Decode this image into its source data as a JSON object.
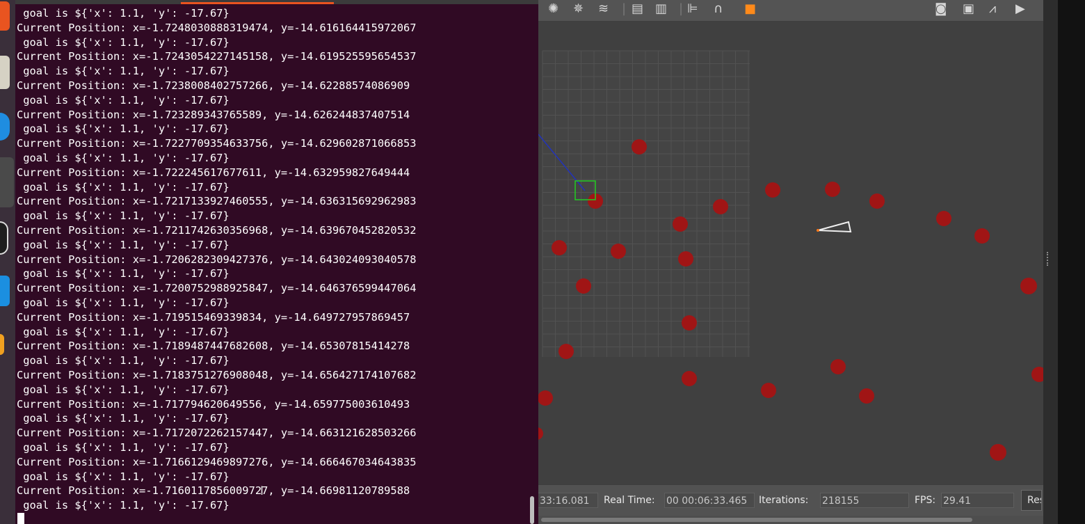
{
  "terminal": {
    "lines": [
      " goal is ${'x': 1.1, 'y': -17.67}",
      "Current Position: x=-1.7248030888319474, y=-14.616164415972067",
      " goal is ${'x': 1.1, 'y': -17.67}",
      "Current Position: x=-1.7243054227145158, y=-14.619525595654537",
      " goal is ${'x': 1.1, 'y': -17.67}",
      "Current Position: x=-1.7238008402757266, y=-14.62288574086909",
      " goal is ${'x': 1.1, 'y': -17.67}",
      "Current Position: x=-1.723289343765589, y=-14.626244837407514",
      " goal is ${'x': 1.1, 'y': -17.67}",
      "Current Position: x=-1.7227709354633756, y=-14.629602871066853",
      " goal is ${'x': 1.1, 'y': -17.67}",
      "Current Position: x=-1.722245617677611, y=-14.632959827649444",
      " goal is ${'x': 1.1, 'y': -17.67}",
      "Current Position: x=-1.7217133927460555, y=-14.636315692962983",
      " goal is ${'x': 1.1, 'y': -17.67}",
      "Current Position: x=-1.7211742630356968, y=-14.639670452820532",
      " goal is ${'x': 1.1, 'y': -17.67}",
      "Current Position: x=-1.7206282309427376, y=-14.643024093040578",
      " goal is ${'x': 1.1, 'y': -17.67}",
      "Current Position: x=-1.7200752988925847, y=-14.646376599447064",
      " goal is ${'x': 1.1, 'y': -17.67}",
      "Current Position: x=-1.719515469339834, y=-14.649727957869457",
      " goal is ${'x': 1.1, 'y': -17.67}",
      "Current Position: x=-1.7189487447682608, y=-14.65307815414278",
      " goal is ${'x': 1.1, 'y': -17.67}",
      "Current Position: x=-1.7183751276908048, y=-14.656427174107682",
      " goal is ${'x': 1.1, 'y': -17.67}",
      "Current Position: x=-1.717794620649556, y=-14.659775003610493",
      " goal is ${'x': 1.1, 'y': -17.67}",
      "Current Position: x=-1.7172072262157447, y=-14.663121628503266",
      " goal is ${'x': 1.1, 'y': -17.67}",
      "Current Position: x=-1.7166129469897276, y=-14.666467034643835",
      " goal is ${'x': 1.1, 'y': -17.67}",
      "Current Position: x=-1.7160117856009727, y=-14.66981120789588",
      " goal is ${'x': 1.1, 'y': -17.67}"
    ],
    "colors": {
      "background": "#300a24",
      "text": "#ffffff",
      "tab_accent": "#e95420"
    }
  },
  "dock": {
    "icons": [
      "ubuntu-software-icon",
      "files-icon",
      "browser-icon",
      "app-icon",
      "github-icon",
      "vscode-icon",
      "terminal-icon"
    ]
  },
  "gazebo": {
    "toolbar_icons": [
      "sun-light-icon",
      "spot-light-icon",
      "directional-light-icon",
      "copy-icon",
      "paste-icon",
      "align-icon",
      "snap-magnet-icon",
      "color-box-icon",
      "screenshot-camera-icon",
      "log-icon",
      "plot-icon",
      "video-record-icon"
    ],
    "status": {
      "sim_time_value": "33:16.081",
      "real_time_label": "Real Time:",
      "real_time_value": "00 00:06:33.465",
      "iterations_label": "Iterations:",
      "iterations_value": "218155",
      "fps_label": "FPS:",
      "fps_value": "29.41",
      "reset_label": "Reset"
    },
    "colors": {
      "obstacle": "#a01515",
      "ground": "#404040",
      "goal_box": "#22cc22",
      "path_line": "#2233bb"
    }
  }
}
